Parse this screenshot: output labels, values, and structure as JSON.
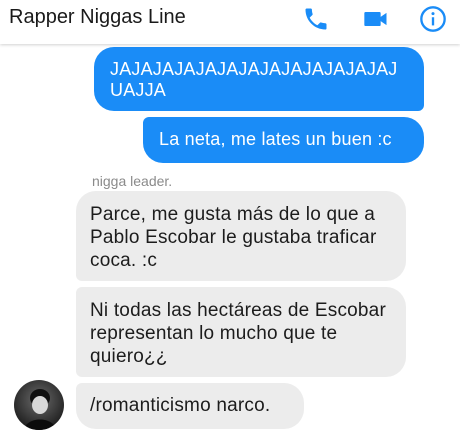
{
  "header": {
    "title": "Rapper Niggas Line",
    "icons": [
      "phone-icon",
      "video-camera-icon",
      "info-icon"
    ],
    "accent_color": "#1a8cf7"
  },
  "messages": [
    {
      "direction": "sent",
      "text": "JAJAJAJAJAJAJAJAJAJAJAJAJAJUAJJA"
    },
    {
      "direction": "sent",
      "text": "La neta, me lates un buen :c"
    },
    {
      "direction": "received",
      "sender": "nigga leader.",
      "text": "Parce, me gusta más de lo que a Pablo Escobar le gustaba traficar coca. :c"
    },
    {
      "direction": "received",
      "text": "Ni todas las hectáreas de Escobar representan lo mucho que te quiero¿¿"
    },
    {
      "direction": "received",
      "text": "/romanticismo narco."
    }
  ],
  "colors": {
    "sent_bubble": "#1a8cf7",
    "received_bubble": "#ececec"
  }
}
